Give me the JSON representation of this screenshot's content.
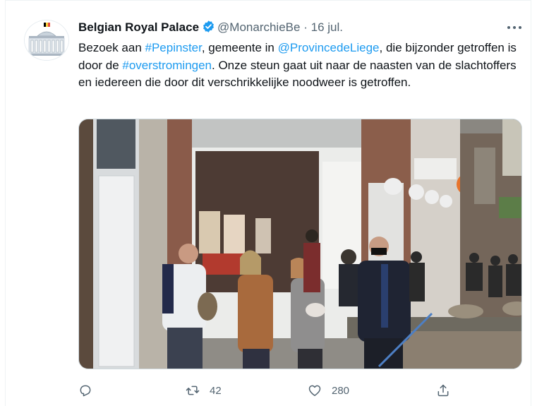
{
  "tweet": {
    "author_name": "Belgian Royal Palace",
    "handle": "@MonarchieBe",
    "separator": "·",
    "date": "16 jul.",
    "text_parts": [
      {
        "text": "Bezoek aan ",
        "link": false
      },
      {
        "text": "#Pepinster",
        "link": true
      },
      {
        "text": ", gemeente in ",
        "link": false
      },
      {
        "text": "@ProvincedeLiege",
        "link": true
      },
      {
        "text": ", die bijzonder getroffen is door de ",
        "link": false
      },
      {
        "text": "#overstromingen",
        "link": true
      },
      {
        "text": ". Onze steun gaat uit naar de naasten van de slachtoffers en iedereen die door dit verschrikkelijke noodweer is getroffen.",
        "link": false
      }
    ],
    "retweet_count": "42",
    "like_count": "280"
  },
  "colors": {
    "accent": "#1d9bf0",
    "secondary_text": "#536471",
    "primary_text": "#0f1419"
  },
  "icons": [
    "royal-palace-avatar-icon",
    "verified-badge-icon",
    "more-icon",
    "reply-icon",
    "retweet-icon",
    "like-icon",
    "share-icon"
  ]
}
